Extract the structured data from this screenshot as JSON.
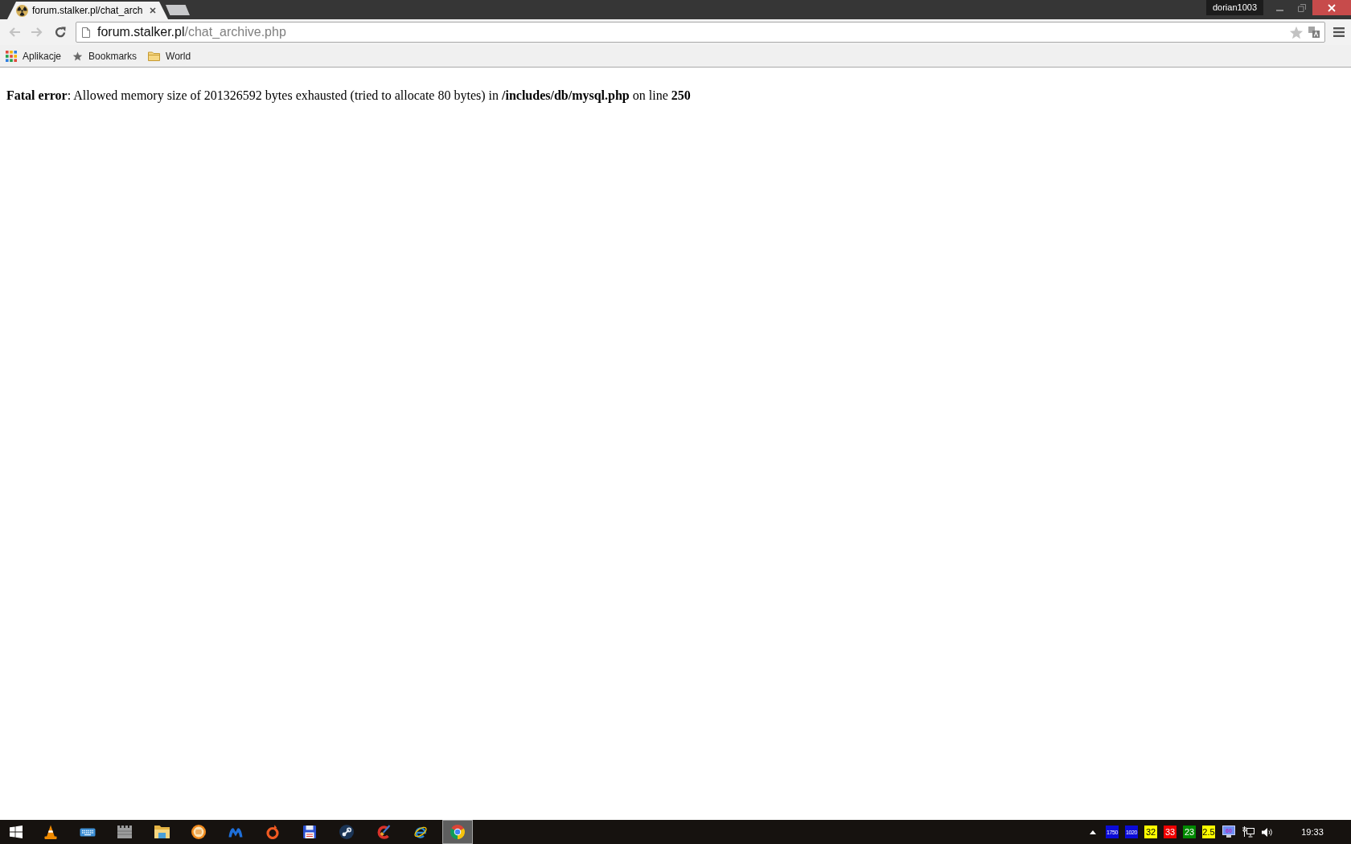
{
  "browser": {
    "tabs": [
      {
        "title": "forum.stalker.pl/chat_arch",
        "selected": true
      }
    ],
    "profile": "dorian1003",
    "toolbar": {
      "back": {
        "disabled": true
      },
      "forward": {
        "disabled": true
      }
    },
    "address_bar": {
      "host": "forum.stalker.pl",
      "path": "/chat_archive.php"
    },
    "bookmarks": [
      {
        "kind": "apps",
        "label": "Aplikacje"
      },
      {
        "kind": "bookmark",
        "label": "Bookmarks"
      },
      {
        "kind": "folder",
        "label": "World"
      }
    ]
  },
  "page": {
    "message": "**Fatal error**: Allowed memory size of 201326592 bytes exhausted (tried to allocate 80 bytes) in **/includes/db/mysql.php** on line **250**"
  },
  "taskbar": {
    "apps": [
      {
        "kind": "cone",
        "selected": false
      },
      {
        "kind": "keyboard",
        "selected": false
      },
      {
        "kind": "battlement",
        "selected": false
      },
      {
        "kind": "folder",
        "selected": false
      },
      {
        "kind": "lined-disc",
        "selected": false
      },
      {
        "kind": "m-mark",
        "selected": false
      },
      {
        "kind": "ring",
        "selected": false
      },
      {
        "kind": "floppy",
        "selected": false
      },
      {
        "kind": "piston-disc",
        "selected": false
      },
      {
        "kind": "c-brush",
        "selected": false
      },
      {
        "kind": "e-orbit",
        "selected": false
      },
      {
        "kind": "segmented-circle",
        "selected": true
      }
    ],
    "tray": [
      {
        "kind": "counter",
        "label": "1750",
        "color": "#0b0bd8"
      },
      {
        "kind": "counter",
        "label": "1020",
        "color": "#0b0bd8"
      },
      {
        "kind": "counter",
        "label": "32",
        "color": "#ffff00"
      },
      {
        "kind": "counter",
        "label": "33",
        "color": "#ee0000"
      },
      {
        "kind": "counter",
        "label": "23",
        "color": "#008a00"
      },
      {
        "kind": "counter",
        "label": "2.5",
        "color": "#ffff00"
      },
      {
        "kind": "monitor",
        "label": "60"
      }
    ],
    "clock": "19:33"
  }
}
